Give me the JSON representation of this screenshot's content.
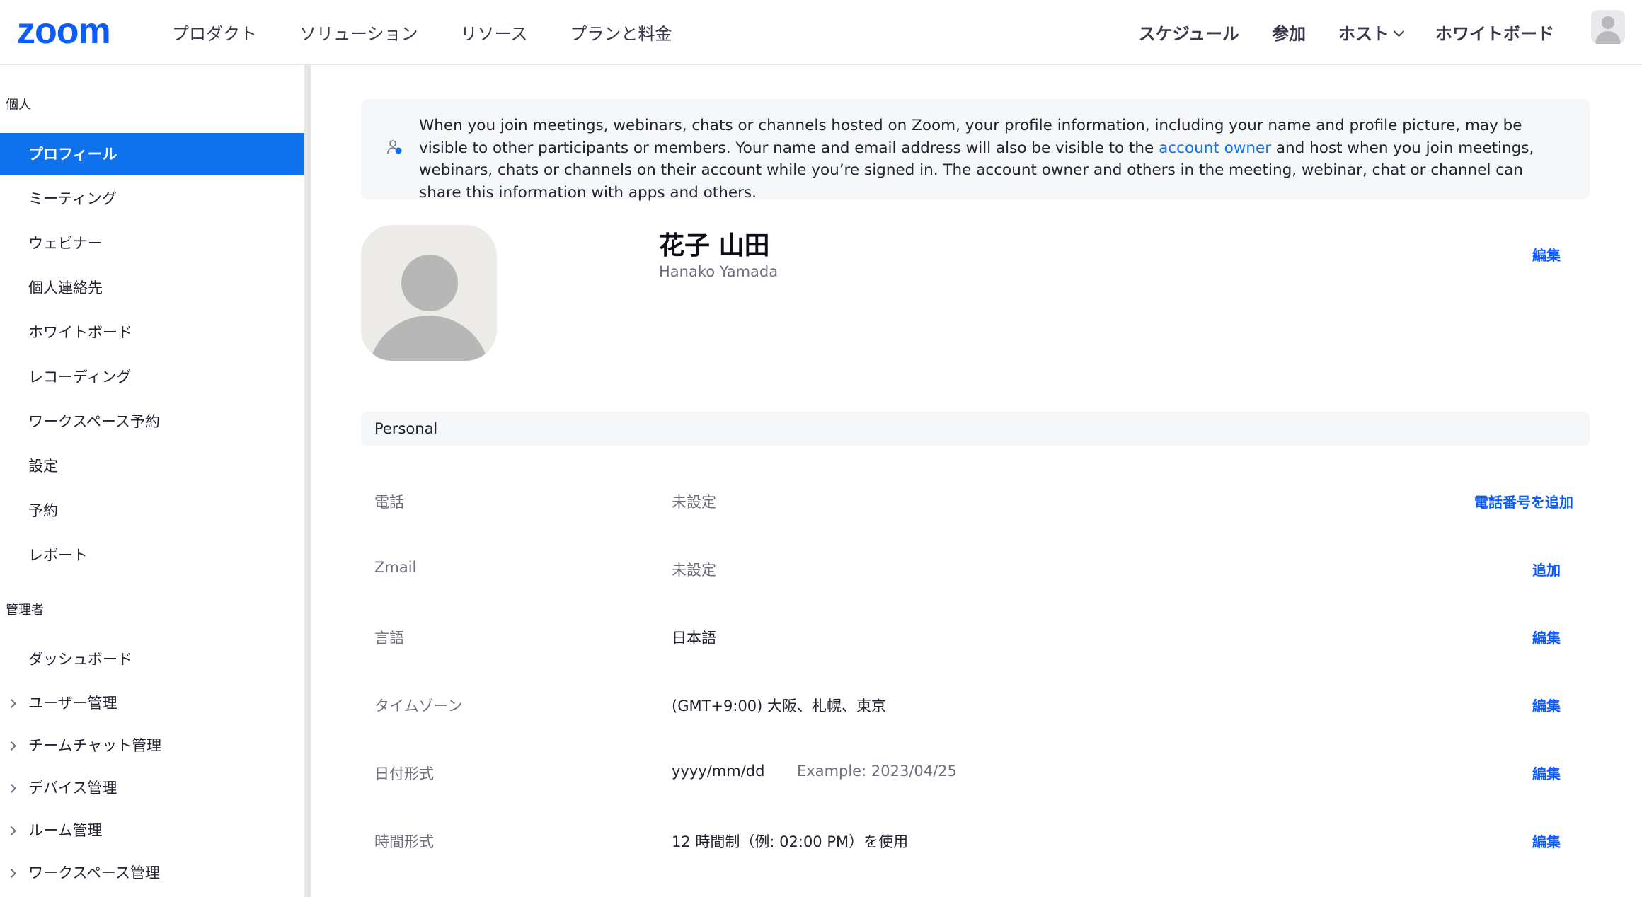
{
  "nav": {
    "logo": "zoom",
    "left_items": [
      "プロダクト",
      "ソリューション",
      "リソース",
      "プランと料金"
    ],
    "right_items": {
      "schedule": "スケジュール",
      "join": "参加",
      "host": "ホスト",
      "whiteboard": "ホワイトボード"
    }
  },
  "sidebar": {
    "personal_label": "個人",
    "personal_items": [
      "プロフィール",
      "ミーティング",
      "ウェビナー",
      "個人連絡先",
      "ホワイトボード",
      "レコーディング",
      "ワークスペース予約",
      "設定",
      "予約",
      "レポート"
    ],
    "active_item": "プロフィール",
    "admin_label": "管理者",
    "admin_items": [
      "ダッシュボード",
      "ユーザー管理",
      "チームチャット管理",
      "デバイス管理",
      "ルーム管理",
      "ワークスペース管理"
    ]
  },
  "notice": {
    "text_before": "When you join meetings, webinars, chats or channels hosted on Zoom, your profile information, including your name and profile picture, may be visible to other participants or members. Your name and email address will also be visible to the ",
    "link": "account owner",
    "text_after": " and host when you join meetings, webinars, chats or channels on their account while you’re signed in. The account owner and others in the meeting, webinar, chat or channel can share this information with apps and others."
  },
  "profile": {
    "display_name": "花子 山田",
    "alt_name": "Hanako Yamada",
    "edit": "編集"
  },
  "personal": {
    "title": "Personal",
    "phone": {
      "label": "電話",
      "value": "未設定",
      "action": "電話番号を追加"
    },
    "zmail": {
      "label": "Zmail",
      "value": "未設定",
      "action": "追加"
    },
    "language": {
      "label": "言語",
      "value": "日本語",
      "action": "編集"
    },
    "timezone": {
      "label": "タイムゾーン",
      "value": "(GMT+9:00) 大阪、札幌、東京",
      "action": "編集"
    },
    "date_format": {
      "label": "日付形式",
      "value": "yyyy/mm/dd",
      "example": "Example: 2023/04/25",
      "action": "編集"
    },
    "time_format": {
      "label": "時間形式",
      "value": "12 時間制（例: 02:00 PM）を使用",
      "action": "編集"
    }
  },
  "colors": {
    "brand": "#0b5cff",
    "active_sidebar": "#0e72ed",
    "link": "#0e72ed"
  }
}
